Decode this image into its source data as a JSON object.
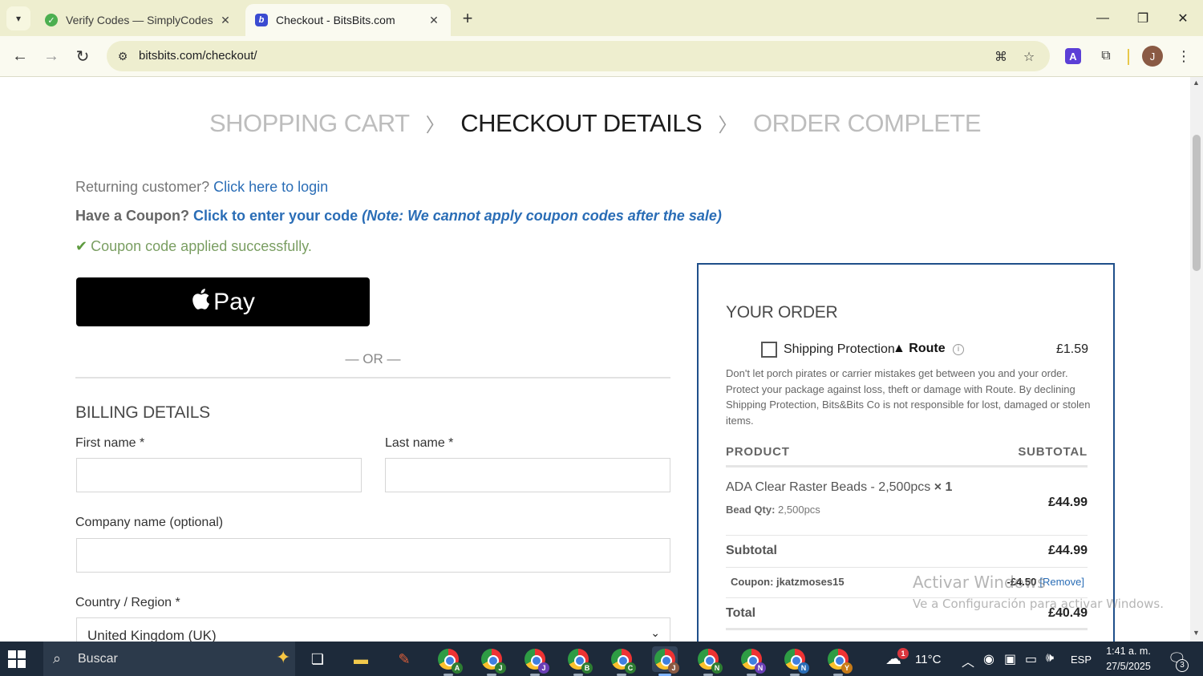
{
  "browser": {
    "tabs": [
      {
        "title": "Verify Codes — SimplyCodes",
        "favicon": "simplycodes-icon",
        "active": false
      },
      {
        "title": "Checkout - BitsBits.com",
        "favicon": "bitsbits-icon",
        "active": true
      }
    ],
    "url": "bitsbits.com/checkout/",
    "profile_initial": "J",
    "extension_letter": "A"
  },
  "checkout": {
    "steps": [
      "SHOPPING CART",
      "CHECKOUT DETAILS",
      "ORDER COMPLETE"
    ],
    "active_step": 1,
    "returning_prefix": "Returning customer?",
    "returning_link": "Click here to login",
    "coupon_prefix": "Have a Coupon?",
    "coupon_link": "Click to enter your code",
    "coupon_note": "(Note: We cannot apply coupon codes after the sale)",
    "coupon_success": "Coupon code applied successfully.",
    "apple_pay_label": "Pay",
    "or_label": "— OR —",
    "billing": {
      "title": "BILLING DETAILS",
      "first_name_label": "First name",
      "last_name_label": "Last name",
      "company_label": "Company name (optional)",
      "country_label": "Country / Region",
      "required_marker": "*",
      "country_value": "United Kingdom (UK)",
      "first_name_value": "",
      "last_name_value": "",
      "company_value": ""
    }
  },
  "order": {
    "title": "YOUR ORDER",
    "shipping_protection": {
      "label": "Shipping Protection",
      "brand": "Route",
      "price": "£1.59",
      "checked": false,
      "description": "Don't let porch pirates or carrier mistakes get between you and your order. Protect your package against loss, theft or damage with Route. By declining Shipping Protection, Bits&Bits Co is not responsible for lost, damaged or stolen items."
    },
    "columns": {
      "product": "PRODUCT",
      "subtotal": "SUBTOTAL"
    },
    "items": [
      {
        "name": "ADA Clear Raster Beads - 2,500pcs",
        "qty": "× 1",
        "meta_label": "Bead Qty:",
        "meta_value": "2,500pcs",
        "price": "£44.99"
      }
    ],
    "subtotal_label": "Subtotal",
    "subtotal_value": "£44.99",
    "coupon_label": "Coupon: jkatzmoses15",
    "coupon_value": "-£4.50",
    "coupon_remove": "[Remove]",
    "total_label": "Total",
    "total_value": "£40.49"
  },
  "watermark": {
    "line1": "Activar Windows",
    "line2": "Ve a Configuración para activar Windows."
  },
  "taskbar": {
    "search_placeholder": "Buscar",
    "weather": "11°C",
    "weather_badge": "1",
    "language": "ESP",
    "time": "1:41 a. m.",
    "date": "27/5/2025",
    "notification_count": "3",
    "chrome_profiles": [
      "A",
      "J",
      "J",
      "B",
      "C",
      "J",
      "N",
      "N",
      "N",
      "Y"
    ]
  }
}
